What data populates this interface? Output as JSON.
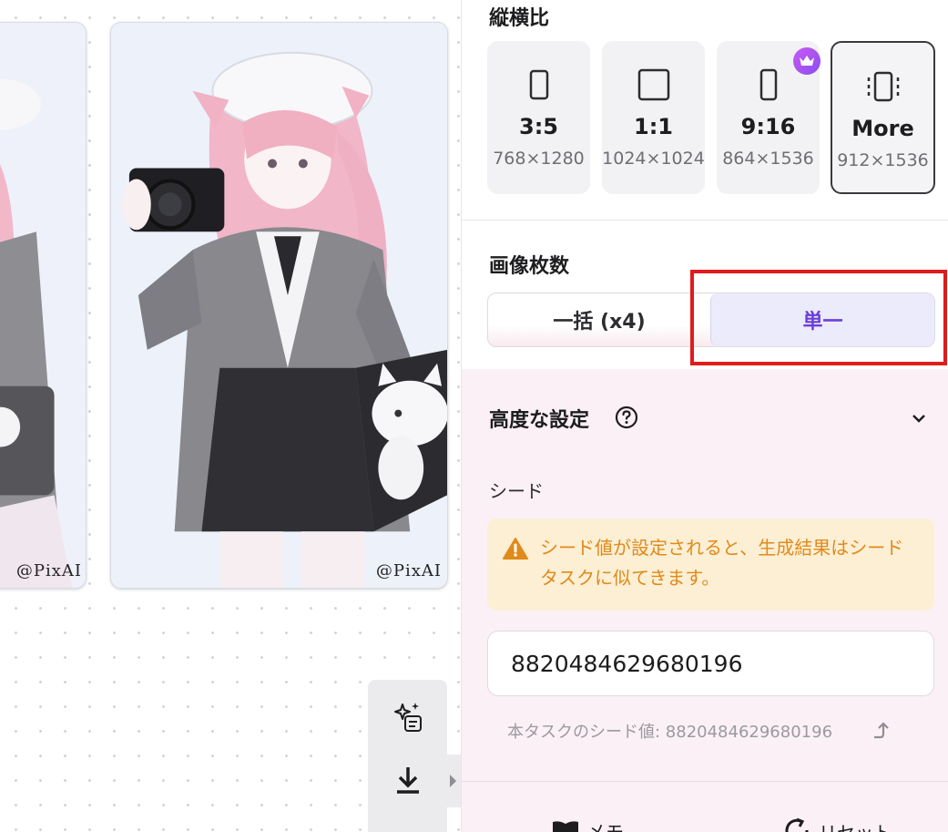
{
  "gallery": {
    "watermark_left": "@PixAI",
    "watermark_main": "@PixAI"
  },
  "aspect_ratio": {
    "title": "縦横比",
    "options": [
      {
        "label": "3:5",
        "size": "768×1280",
        "icon": "portrait-rect-icon",
        "selected": false,
        "premium": false
      },
      {
        "label": "1:1",
        "size": "1024×1024",
        "icon": "square-icon",
        "selected": false,
        "premium": false
      },
      {
        "label": "9:16",
        "size": "864×1536",
        "icon": "tall-rect-icon",
        "selected": false,
        "premium": true
      },
      {
        "label": "More",
        "size": "912×1536",
        "icon": "more-ratio-icon",
        "selected": true,
        "premium": false
      }
    ]
  },
  "image_count": {
    "title": "画像枚数",
    "batch_label": "一括 (x4)",
    "single_label": "単一",
    "selected": "single"
  },
  "advanced": {
    "title": "高度な設定",
    "seed_label": "シード",
    "warning_text": "シード値が設定されると、生成結果はシードタスクに似てきます。",
    "seed_value": "8820484629680196",
    "task_seed_text": "本タスクのシード値: 8820484629680196"
  },
  "footer": {
    "memo_label": "メモ",
    "reset_label": "リセット"
  },
  "colors": {
    "accent_purple": "#6b3fd6",
    "highlight_red": "#e11b1b",
    "warning_orange": "#e08a1a",
    "panel_pink": "#fbf0f5"
  }
}
